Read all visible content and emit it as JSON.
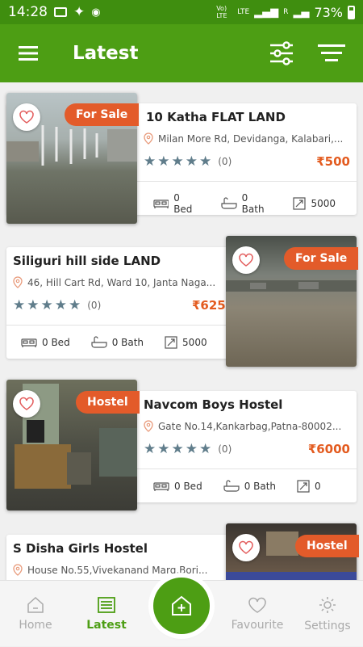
{
  "status": {
    "time": "14:28",
    "network1": "Vo) LTE",
    "network2": "LTE",
    "roaming": "R",
    "battery": "73%"
  },
  "appbar": {
    "title": "Latest"
  },
  "listings": [
    {
      "title": "10 Katha  FLAT LAND",
      "address": "Milan More Rd, Devidanga, Kalabari,...",
      "rating_count": "(0)",
      "price": "₹500",
      "bed": "0 Bed",
      "bath": "0 Bath",
      "area": "5000",
      "tag": "For Sale"
    },
    {
      "title": "Siliguri hill  side  LAND",
      "address": "46, Hill Cart Rd, Ward 10, Janta Naga...",
      "rating_count": "(0)",
      "price": "₹625",
      "bed": "0 Bed",
      "bath": "0 Bath",
      "area": "5000",
      "tag": "For Sale"
    },
    {
      "title": "Navcom Boys Hostel",
      "address": "Gate No.14,Kankarbag,Patna-80002...",
      "rating_count": "(0)",
      "price": "₹6000",
      "bed": "0 Bed",
      "bath": "0 Bath",
      "area": "0",
      "tag": "Hostel"
    },
    {
      "title": "S Disha Girls Hostel",
      "address": "House No.55,Vivekanand Marg,Bori...",
      "tag": "Hostel"
    }
  ],
  "nav": {
    "home": "Home",
    "latest": "Latest",
    "favourite": "Favourite",
    "settings": "Settings"
  },
  "colors": {
    "primary": "#4d9e14",
    "status": "#3f8e0f",
    "accent": "#e35b2a",
    "star": "#607d8b"
  }
}
